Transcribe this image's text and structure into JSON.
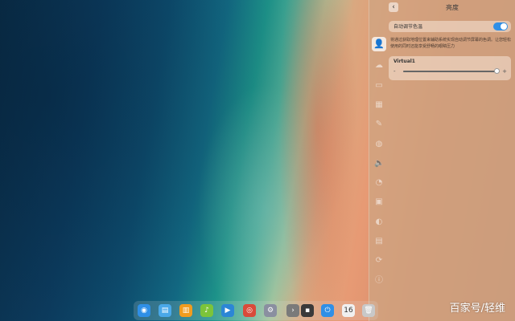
{
  "panel": {
    "title": "亮度",
    "back_icon": "‹",
    "auto_label": "自动调节色温",
    "auto_enabled": true,
    "description": "将通过获取地理位置来辅助系统实现自动调节屏幕的色调。让您轻松使用的同时还能享受舒畅的眼睛压力",
    "display": {
      "name": "Virtual1",
      "minus": "-",
      "plus": "+",
      "brightness_fraction": 0.97
    }
  },
  "rail_icons": [
    {
      "name": "account-icon",
      "glyph": "👤",
      "active": true
    },
    {
      "name": "cloud-icon",
      "glyph": "☁"
    },
    {
      "name": "display-icon",
      "glyph": "▭"
    },
    {
      "name": "calendar-icon",
      "glyph": "▦"
    },
    {
      "name": "personalization-icon",
      "glyph": "✎"
    },
    {
      "name": "network-icon",
      "glyph": "◍"
    },
    {
      "name": "sound-icon",
      "glyph": "🔈"
    },
    {
      "name": "time-icon",
      "glyph": "◔"
    },
    {
      "name": "power-icon",
      "glyph": "▣"
    },
    {
      "name": "mouse-icon",
      "glyph": "◐"
    },
    {
      "name": "keyboard-icon",
      "glyph": "▤"
    },
    {
      "name": "update-icon",
      "glyph": "⟳"
    },
    {
      "name": "info-icon",
      "glyph": "ⓘ"
    }
  ],
  "dock_items": [
    {
      "name": "launcher-icon",
      "glyph": "◉",
      "color": "#2f8fe6"
    },
    {
      "name": "file-manager-icon",
      "glyph": "▤",
      "color": "#4aa8e8"
    },
    {
      "name": "app-store-icon",
      "glyph": "▥",
      "color": "#f29c1f"
    },
    {
      "name": "music-icon",
      "glyph": "♪",
      "color": "#7cc43a"
    },
    {
      "name": "video-icon",
      "glyph": "▶",
      "color": "#2c86d6"
    },
    {
      "name": "chrome-icon",
      "glyph": "◎",
      "color": "#d94a3a"
    },
    {
      "name": "settings-icon",
      "glyph": "⚙",
      "color": "#8a8fa0"
    },
    {
      "name": "arrow-icon",
      "glyph": "›",
      "color": "#7a7a7a"
    },
    {
      "name": "terminal-icon",
      "glyph": "▪",
      "color": "#3a3a3a"
    },
    {
      "name": "power-icon",
      "glyph": "⏻",
      "color": "#2f8fe6"
    },
    {
      "name": "datetime-icon",
      "glyph": "16",
      "color": "#f0f0f0"
    },
    {
      "name": "trash-icon",
      "glyph": "🗑",
      "color": "#c8c8c8"
    }
  ],
  "watermark": "百家号/轻维"
}
